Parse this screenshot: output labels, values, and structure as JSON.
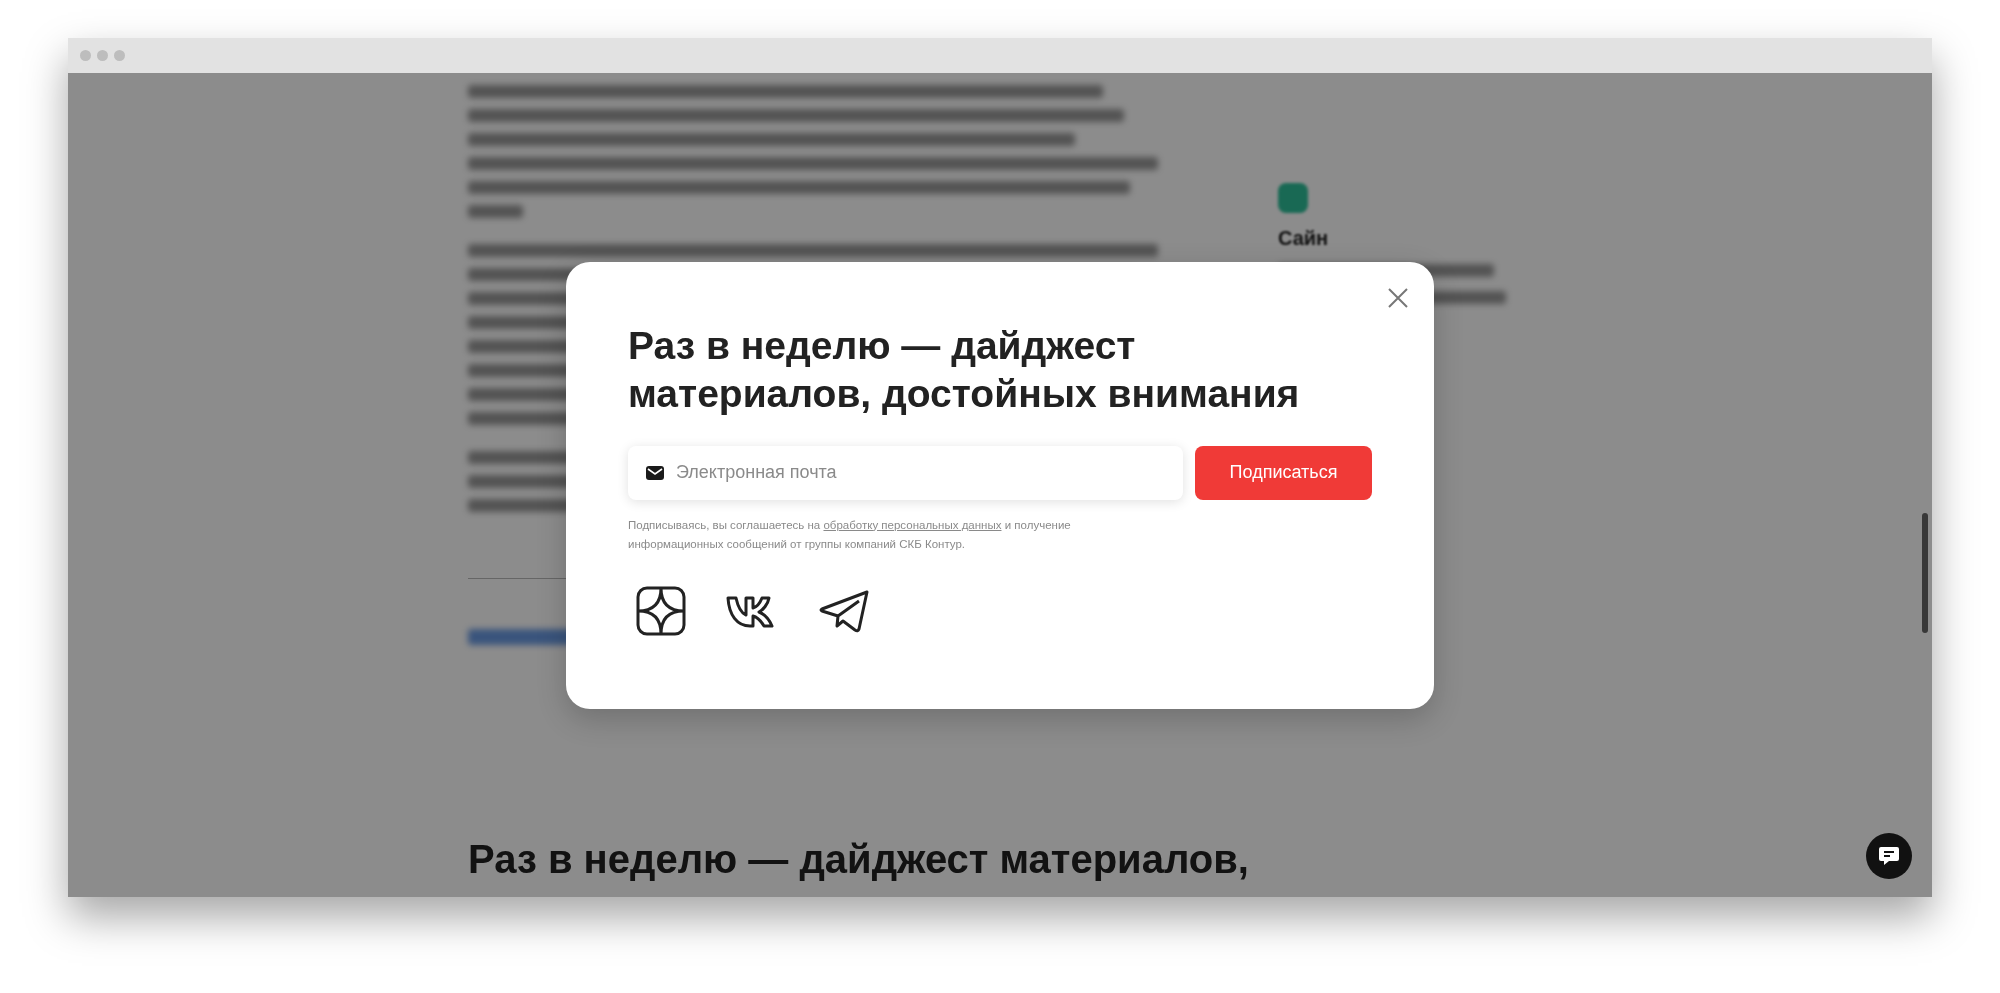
{
  "background_page": {
    "sidebar_title": "Сайн",
    "bottom_heading": "Раз в неделю — дайджест материалов,"
  },
  "modal": {
    "title_lines": [
      "Раз в неделю — дайджест",
      "материалов, достойных внимания"
    ],
    "email_field": {
      "placeholder": "Электронная почта"
    },
    "subscribe_button": "Подписаться",
    "consent": {
      "before": "Подписываясь, вы соглашаетесь на",
      "link": "обработку персональных данных",
      "after": "и получение информационных сообщений от группы компаний СКБ Контур."
    },
    "social_links": [
      {
        "kind": "sparkle"
      },
      {
        "kind": "vk"
      },
      {
        "kind": "plane"
      }
    ]
  }
}
